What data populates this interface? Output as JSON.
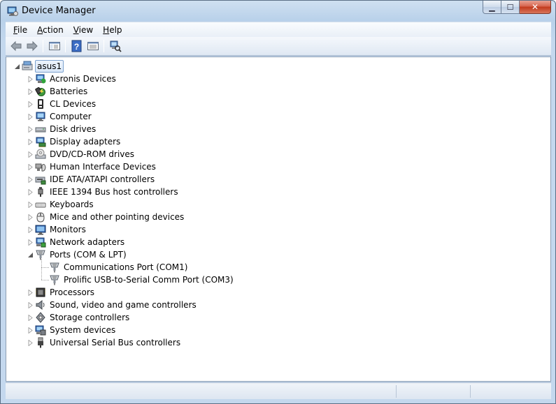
{
  "window": {
    "title": "Device Manager",
    "minimize_glyph": "▁",
    "maximize_glyph": "☐",
    "close_glyph": "✕"
  },
  "menu": [
    {
      "label": "File",
      "access": "F"
    },
    {
      "label": "Action",
      "access": "A"
    },
    {
      "label": "View",
      "access": "V"
    },
    {
      "label": "Help",
      "access": "H"
    }
  ],
  "toolbar": [
    {
      "icon": "back-arrow-icon"
    },
    {
      "icon": "forward-arrow-icon"
    },
    {
      "icon": "show-hide-console-tree-icon"
    },
    {
      "icon": "help-icon"
    },
    {
      "icon": "properties-icon"
    },
    {
      "icon": "scan-hardware-changes-icon"
    }
  ],
  "tree": {
    "root": {
      "label": "asus1",
      "icon": "computer-icon",
      "expanded": true
    },
    "categories": [
      {
        "label": "Acronis Devices",
        "icon": "acronis-device-icon",
        "expanded": false
      },
      {
        "label": "Batteries",
        "icon": "battery-icon",
        "expanded": false
      },
      {
        "label": "CL Devices",
        "icon": "cl-device-icon",
        "expanded": false
      },
      {
        "label": "Computer",
        "icon": "monitor-computer-icon",
        "expanded": false
      },
      {
        "label": "Disk drives",
        "icon": "disk-drive-icon",
        "expanded": false
      },
      {
        "label": "Display adapters",
        "icon": "display-adapter-icon",
        "expanded": false
      },
      {
        "label": "DVD/CD-ROM drives",
        "icon": "dvd-drive-icon",
        "expanded": false
      },
      {
        "label": "Human Interface Devices",
        "icon": "hid-icon",
        "expanded": false
      },
      {
        "label": "IDE ATA/ATAPI controllers",
        "icon": "ide-controller-icon",
        "expanded": false
      },
      {
        "label": "IEEE 1394 Bus host controllers",
        "icon": "ieee1394-icon",
        "expanded": false
      },
      {
        "label": "Keyboards",
        "icon": "keyboard-icon",
        "expanded": false
      },
      {
        "label": "Mice and other pointing devices",
        "icon": "mouse-icon",
        "expanded": false
      },
      {
        "label": "Monitors",
        "icon": "monitor-icon",
        "expanded": false
      },
      {
        "label": "Network adapters",
        "icon": "network-adapter-icon",
        "expanded": false
      },
      {
        "label": "Ports (COM & LPT)",
        "icon": "port-icon",
        "expanded": true,
        "children": [
          {
            "label": "Communications Port (COM1)",
            "icon": "port-icon"
          },
          {
            "label": "Prolific USB-to-Serial Comm Port (COM3)",
            "icon": "port-icon"
          }
        ]
      },
      {
        "label": "Processors",
        "icon": "processor-icon",
        "expanded": false
      },
      {
        "label": "Sound, video and game controllers",
        "icon": "speaker-icon",
        "expanded": false
      },
      {
        "label": "Storage controllers",
        "icon": "storage-controller-icon",
        "expanded": false
      },
      {
        "label": "System devices",
        "icon": "system-device-icon",
        "expanded": false
      },
      {
        "label": "Universal Serial Bus controllers",
        "icon": "usb-icon",
        "expanded": false
      }
    ]
  },
  "colors": {
    "titlebar": "#b9d1ea",
    "close_button": "#c23a1d",
    "selection_border": "#7da2ce"
  }
}
